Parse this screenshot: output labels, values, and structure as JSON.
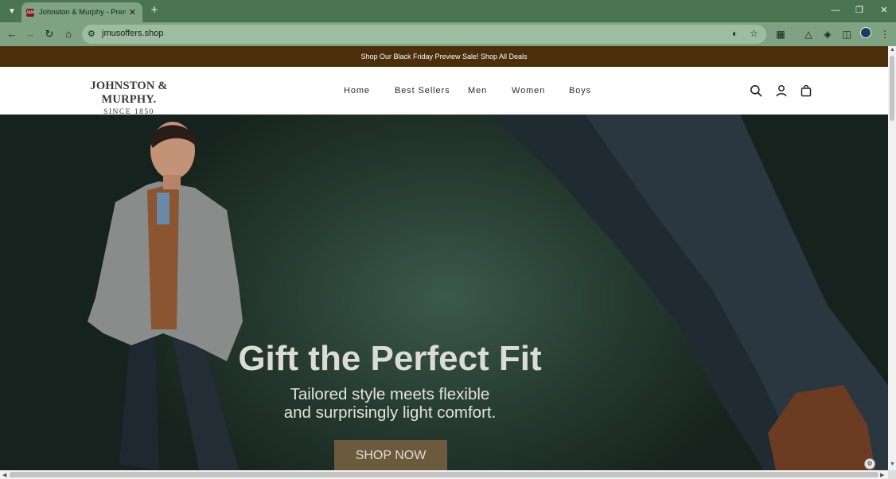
{
  "browser": {
    "tab_title": "Johnston & Murphy - Premium",
    "favicon_text": "J&M",
    "url": "jmusoffers.shop"
  },
  "promo": {
    "text": "Shop Our Black Friday Preview Sale! Shop All Deals"
  },
  "header": {
    "logo_name": "JOHNSTON & MURPHY.",
    "logo_since": "SINCE 1850",
    "nav": [
      "Home",
      "Best Sellers",
      "Men",
      "Women",
      "Boys"
    ]
  },
  "hero": {
    "title": "Gift the Perfect Fit",
    "subtitle_line1": "Tailored style meets flexible",
    "subtitle_line2": "and surprisingly light comfort.",
    "cta": "SHOP NOW"
  },
  "colors": {
    "tab_bar": "#4b7452",
    "toolbar": "#7fa283",
    "promo_bar": "#4b2e0a",
    "hero_bg": "#25392f",
    "cta_bg": "#6b5a3e"
  }
}
